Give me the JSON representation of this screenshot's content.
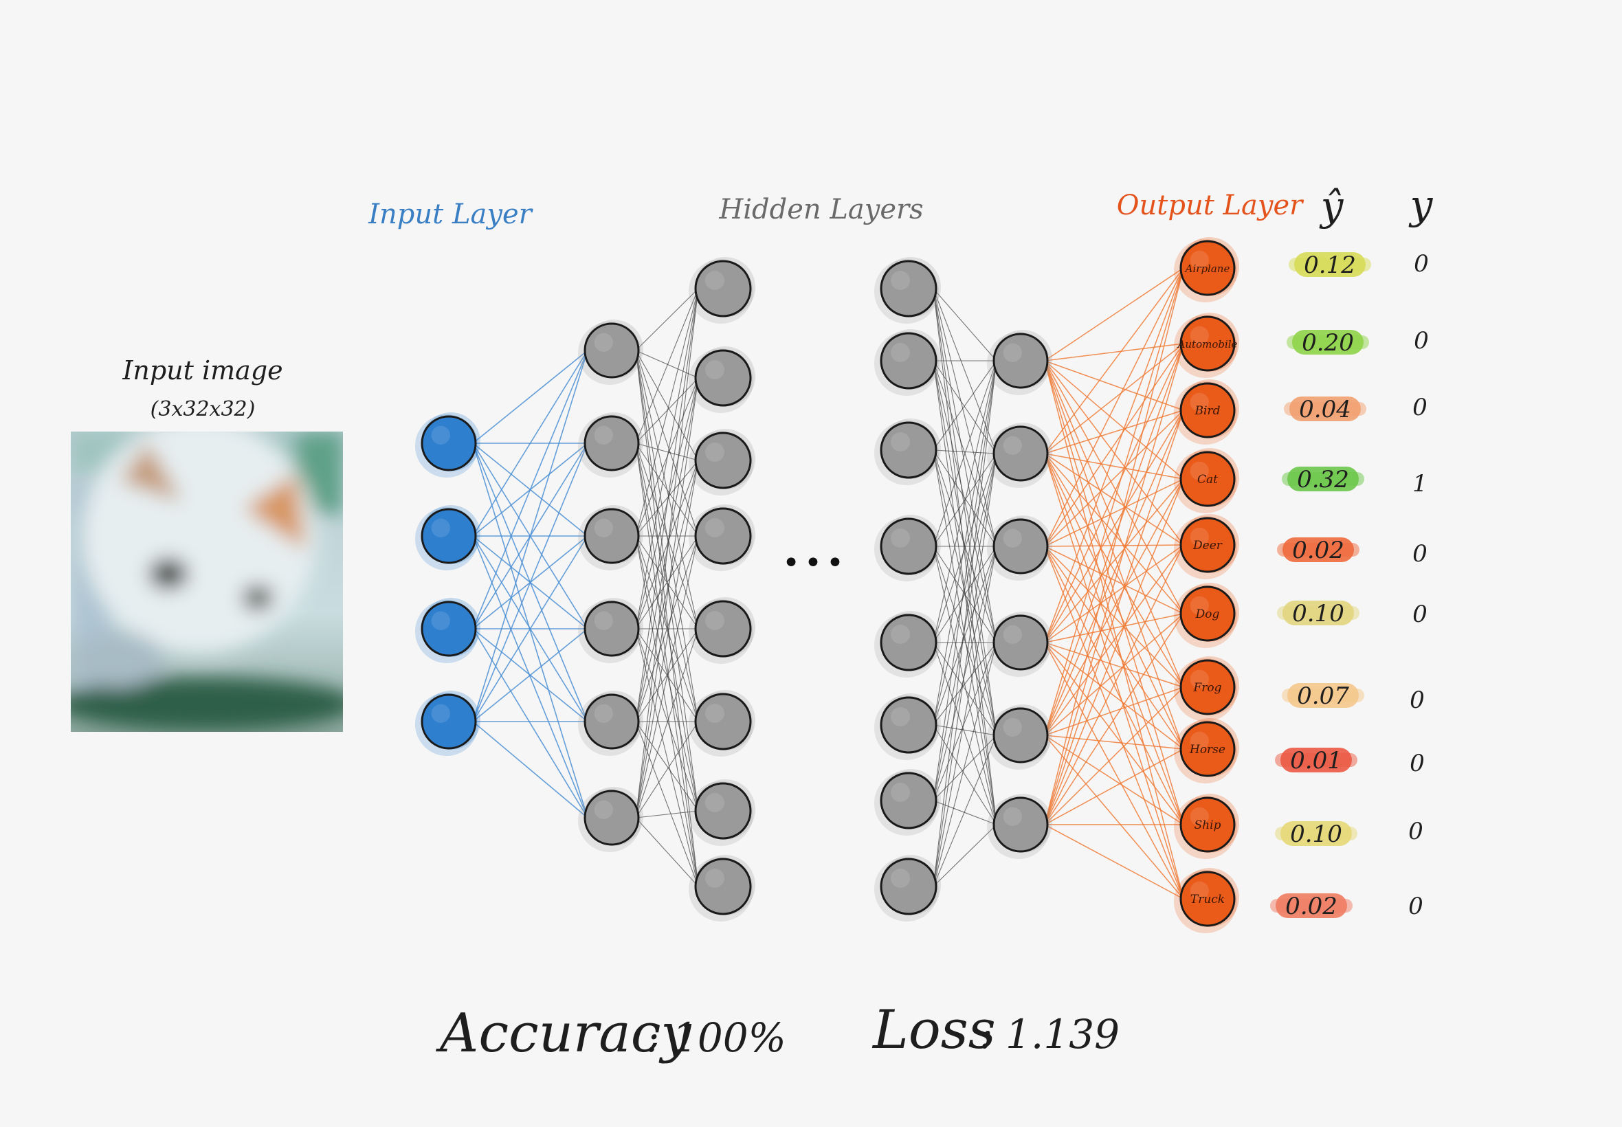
{
  "titles": {
    "input_layer": "Input Layer",
    "hidden_layers": "Hidden Layers",
    "output_layer": "Output Layer",
    "input_image": "Input image",
    "input_shape": "(3x32x32)",
    "y_hat": "ŷ",
    "y": "y",
    "ellipsis": "•••"
  },
  "classes": [
    "Airplane",
    "Automobile",
    "Bird",
    "Cat",
    "Deer",
    "Dog",
    "Frog",
    "Horse",
    "Ship",
    "Truck"
  ],
  "predictions": [
    "0.12",
    "0.20",
    "0.04",
    "0.32",
    "0.02",
    "0.10",
    "0.07",
    "0.01",
    "0.10",
    "0.02"
  ],
  "prediction_colors": [
    "#d7dc57",
    "#8fd44a",
    "#f2a070",
    "#6cc84a",
    "#ef6a3c",
    "#e2d680",
    "#f5c88c",
    "#ec5a44",
    "#e6d878",
    "#ef7c62"
  ],
  "targets": [
    "0",
    "0",
    "0",
    "1",
    "0",
    "0",
    "0",
    "0",
    "0",
    "0"
  ],
  "metrics": {
    "accuracy_label": "Accuracy",
    "accuracy_value": ": 100%",
    "loss_label": "Loss",
    "loss_value": ": 1.139"
  },
  "colors": {
    "input_node": "#2f7fcf",
    "hidden_node": "#9a9a9a",
    "output_node": "#ea5a18",
    "input_edges": "#4a8ed4",
    "hidden_edges": "#3c3c3c",
    "output_edges": "#f07a35",
    "input_title": "#3a7fc4",
    "hidden_title": "#6a6a6a",
    "output_title": "#e5531c"
  }
}
